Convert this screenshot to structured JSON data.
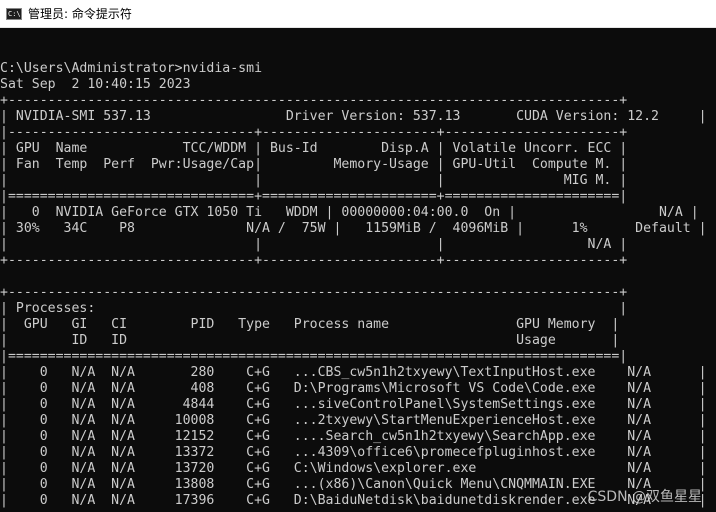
{
  "window": {
    "title": "管理员: 命令提示符",
    "icon": "cmd-icon",
    "icon_text": "C:\\"
  },
  "console_lines": [
    "C:\\Users\\Administrator>nvidia-smi",
    "Sat Sep  2 10:40:15 2023",
    "+-----------------------------------------------------------------------------+",
    "| NVIDIA-SMI 537.13                 Driver Version: 537.13       CUDA Version: 12.2     |",
    "|-------------------------------+----------------------+----------------------+",
    "| GPU  Name            TCC/WDDM | Bus-Id        Disp.A | Volatile Uncorr. ECC |",
    "| Fan  Temp  Perf  Pwr:Usage/Cap|         Memory-Usage | GPU-Util  Compute M. |",
    "|                               |                      |               MIG M. |",
    "|===============================+======================+======================|",
    "|   0  NVIDIA GeForce GTX 1050 Ti   WDDM | 00000000:04:00.0  On |                  N/A |",
    "| 30%   34C    P8              N/A /  75W |   1159MiB /  4096MiB |      1%      Default |",
    "|                               |                      |                  N/A |",
    "+-------------------------------+----------------------+----------------------+",
    "",
    "+-----------------------------------------------------------------------------+",
    "| Processes:                                                                  |",
    "|  GPU   GI   CI        PID   Type   Process name                GPU Memory  |",
    "|        ID   ID                                                 Usage       |",
    "|=============================================================================|",
    "|    0   N/A  N/A       280    C+G   ...CBS_cw5n1h2txyewy\\TextInputHost.exe    N/A      |",
    "|    0   N/A  N/A       408    C+G   D:\\Programs\\Microsoft VS Code\\Code.exe    N/A      |",
    "|    0   N/A  N/A      4844    C+G   ...siveControlPanel\\SystemSettings.exe    N/A      |",
    "|    0   N/A  N/A     10008    C+G   ...2txyewy\\StartMenuExperienceHost.exe    N/A      |",
    "|    0   N/A  N/A     12152    C+G   ....Search_cw5n1h2txyewy\\SearchApp.exe    N/A      |",
    "|    0   N/A  N/A     13372    C+G   ...4309\\office6\\promecefpluginhost.exe    N/A      |",
    "|    0   N/A  N/A     13720    C+G   C:\\Windows\\explorer.exe                   N/A      |",
    "|    0   N/A  N/A     13808    C+G   ...(x86)\\Canon\\Quick Menu\\CNQMMAIN.EXE    N/A      |",
    "|    0   N/A  N/A     17396    C+G   D:\\BaiduNetdisk\\baidunetdiskrender.exe    N/A      |"
  ],
  "watermark": "CSDN @双鱼星星"
}
